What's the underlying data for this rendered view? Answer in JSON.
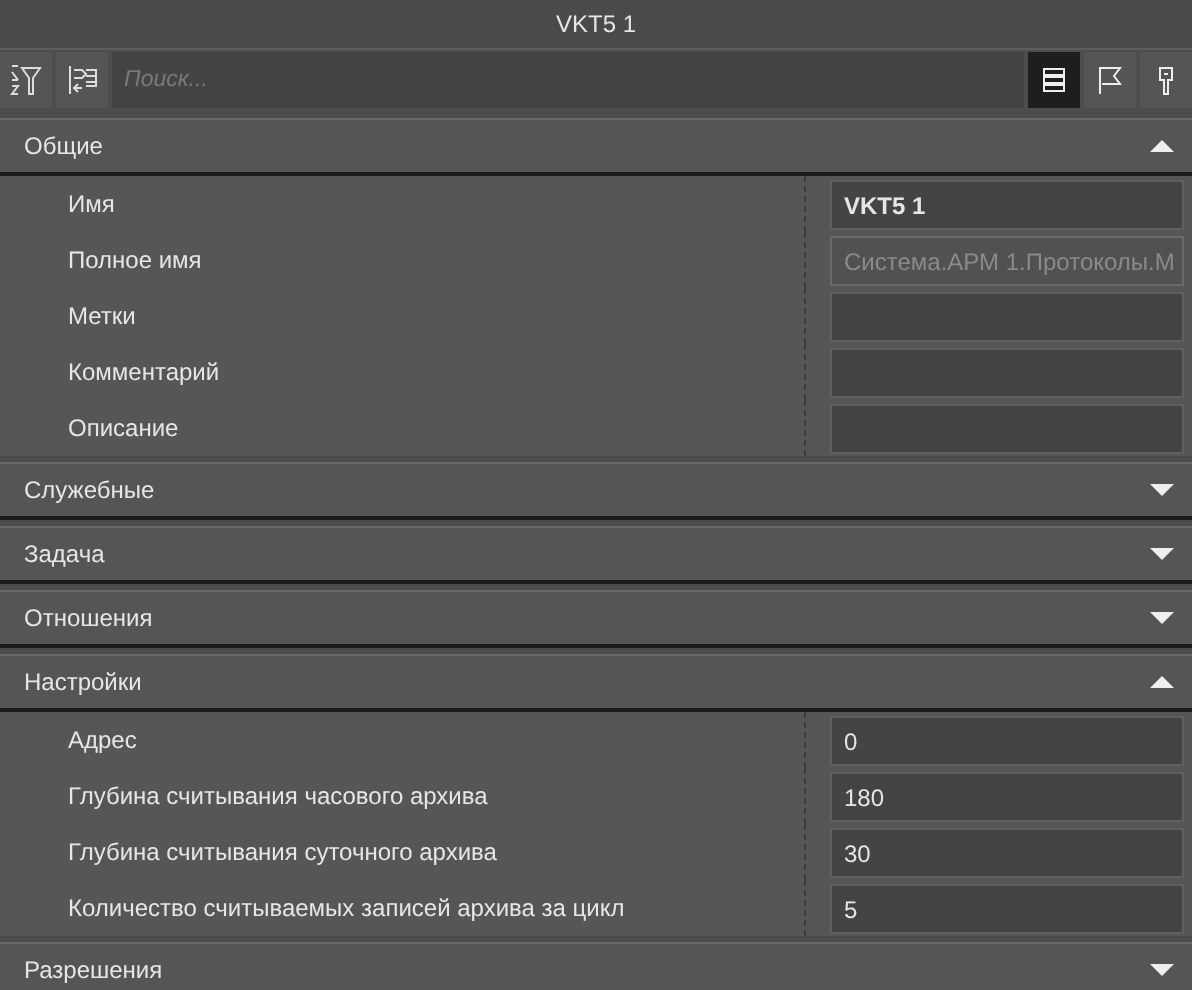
{
  "window": {
    "title": "VKT5 1"
  },
  "toolbar": {
    "search": {
      "placeholder": "Поиск..."
    },
    "view_buttons": [
      {
        "selected": true
      },
      {
        "selected": false
      },
      {
        "selected": false
      }
    ]
  },
  "sections": [
    {
      "title": "Общие",
      "expanded": true,
      "rows": [
        {
          "label": "Имя",
          "value": "VKT5 1",
          "bold": true,
          "disabled": false
        },
        {
          "label": "Полное имя",
          "value": "Система.АРМ 1.Протоколы.М",
          "bold": false,
          "disabled": true
        },
        {
          "label": "Метки",
          "bold": false,
          "disabled": false
        },
        {
          "label": "Комментарий",
          "bold": false,
          "disabled": false
        },
        {
          "label": "Описание",
          "bold": false,
          "disabled": false
        }
      ]
    },
    {
      "title": "Служебные",
      "expanded": false
    },
    {
      "title": "Задача",
      "expanded": false
    },
    {
      "title": "Отношения",
      "expanded": false
    },
    {
      "title": "Настройки",
      "expanded": true,
      "rows": [
        {
          "label": "Адрес",
          "value": "0",
          "bold": false,
          "disabled": false
        },
        {
          "label": "Глубина считывания часового архива",
          "value": "180",
          "bold": false,
          "disabled": false
        },
        {
          "label": "Глубина считывания суточного архива",
          "value": "30",
          "bold": false,
          "disabled": false
        },
        {
          "label": "Количество считываемых записей архива за цикл",
          "value": "5",
          "bold": false,
          "disabled": false
        }
      ]
    },
    {
      "title": "Разрешения",
      "expanded": false
    }
  ]
}
